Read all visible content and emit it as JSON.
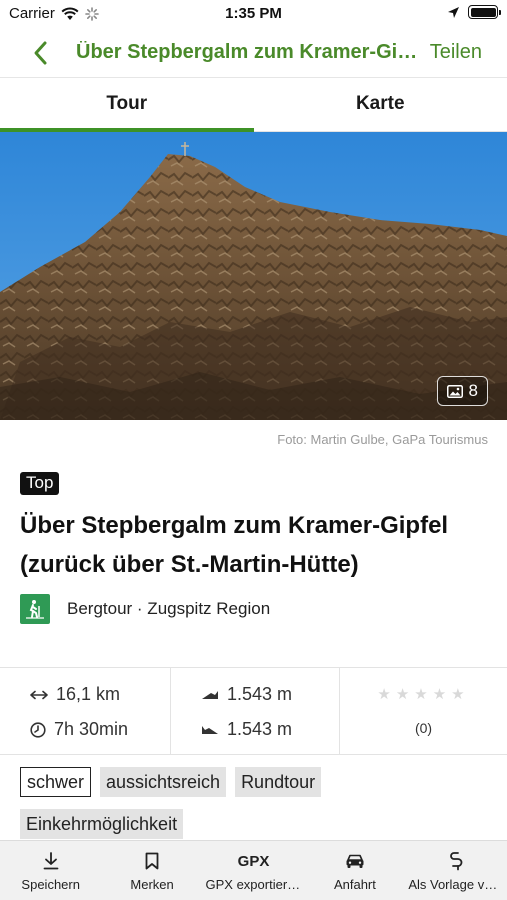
{
  "status_bar": {
    "carrier": "Carrier",
    "time": "1:35 PM"
  },
  "navbar": {
    "title": "Über Stepbergalm zum Kramer-Gipfel (zurück über St.-Martin-Hütte)",
    "share_label": "Teilen"
  },
  "tabs": [
    {
      "label": "Tour",
      "active": true
    },
    {
      "label": "Karte",
      "active": false
    }
  ],
  "hero": {
    "photo_count": "8",
    "credit": "Foto: Martin Gulbe, GaPa Tourismus"
  },
  "tour": {
    "badge": "Top",
    "title": "Über Stepbergalm zum Kramer-Gipfel (zurück über St.-Martin-Hütte)",
    "category": "Bergtour · Zugspitz Region",
    "category_icon_color": "#2f9a55"
  },
  "stats": {
    "distance": "16,1 km",
    "duration": "7h 30min",
    "ascent": "1.543 m",
    "descent": "1.543 m",
    "rating_stars": 0,
    "rating_count": "(0)"
  },
  "tags": [
    {
      "label": "schwer",
      "outlined": true
    },
    {
      "label": "aussichtsreich",
      "outlined": false
    },
    {
      "label": "Rundtour",
      "outlined": false
    },
    {
      "label": "Einkehrmöglichkeit",
      "outlined": false
    }
  ],
  "toolbar": [
    {
      "label": "Speichern",
      "icon": "download-icon"
    },
    {
      "label": "Merken",
      "icon": "bookmark-icon"
    },
    {
      "label": "GPX exportieren",
      "icon": "gpx-icon",
      "icon_text": "GPX"
    },
    {
      "label": "Anfahrt",
      "icon": "car-icon"
    },
    {
      "label": "Als Vorlage verwenden",
      "icon": "route-icon"
    }
  ],
  "colors": {
    "accent": "#4a8a2a",
    "tab_indicator": "#3d9226"
  }
}
